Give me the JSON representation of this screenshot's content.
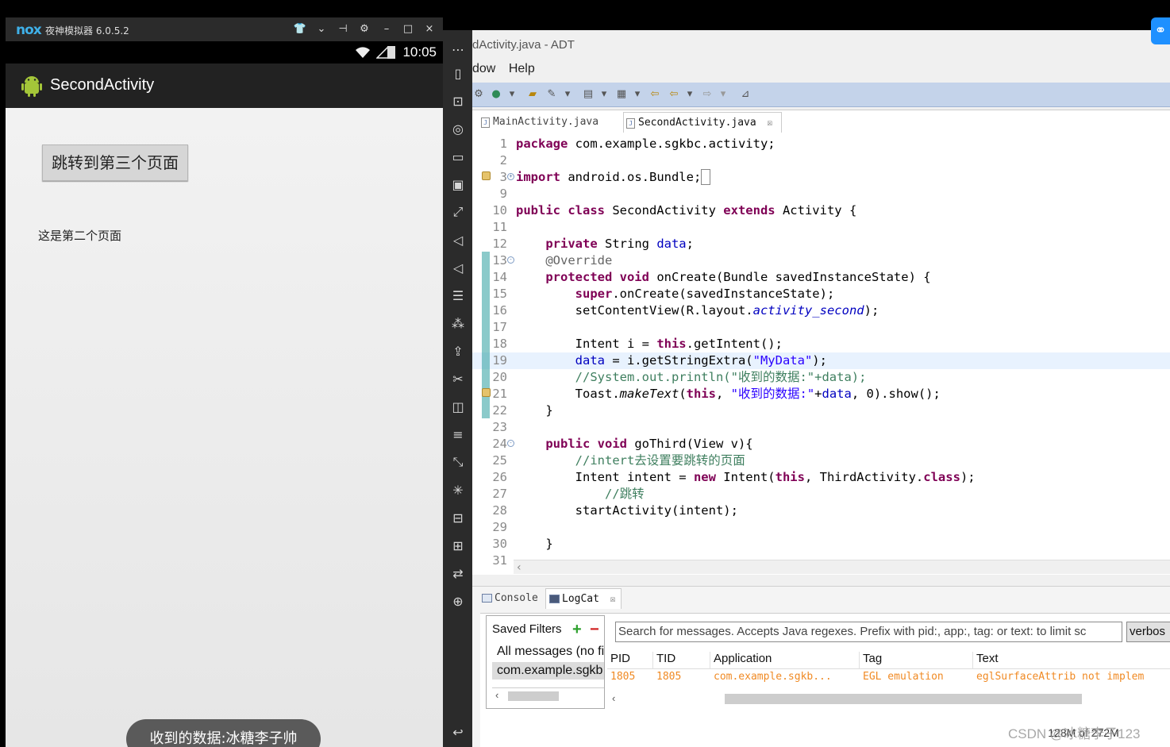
{
  "emulator": {
    "title": "夜神模拟器 6.0.5.2",
    "logo_text": "nox",
    "controls": [
      "shirt-icon",
      "chevron-down-icon",
      "pin-icon",
      "gear-icon",
      "minimize-icon",
      "maximize-icon",
      "close-icon"
    ],
    "status_time": "10:05",
    "app_title": "SecondActivity",
    "button_label": "跳转到第三个页面",
    "page_text": "这是第二个页面",
    "toast": "收到的数据:冰糖李子帅"
  },
  "side_toolbar": [
    "more-icon",
    "phone-icon",
    "robot-icon",
    "location-icon",
    "keyboard-icon",
    "screenshot-icon",
    "fullscreen-icon",
    "volume-up-icon",
    "volume-down-icon",
    "apk-icon",
    "shake-icon",
    "install-icon",
    "cut-icon",
    "multi-window-icon",
    "menu-icon",
    "resize-icon",
    "loading-icon",
    "camera-icon",
    "controller-icon",
    "sync-icon",
    "add-icon",
    "back-icon"
  ],
  "ide": {
    "title": "dActivity.java - ADT",
    "menu": [
      "dow",
      "Help"
    ],
    "tabs": [
      {
        "label": "MainActivity.java",
        "active": false
      },
      {
        "label": "SecondActivity.java",
        "active": true,
        "close": "☒"
      }
    ],
    "code_lines": [
      {
        "n": "1",
        "html": "<span class=\"kw\">package</span> com.example.sgkbc.activity;"
      },
      {
        "n": "2",
        "html": ""
      },
      {
        "n": "3",
        "html": "<span class=\"kw\">import</span> android.os.Bundle;<span style=\"border:1px solid #888;\">&nbsp;</span>",
        "fold": "+"
      },
      {
        "n": "9",
        "html": ""
      },
      {
        "n": "10",
        "html": "<span class=\"kw\">public class</span> SecondActivity <span class=\"kw\">extends</span> Activity {"
      },
      {
        "n": "11",
        "html": ""
      },
      {
        "n": "12",
        "html": "    <span class=\"kw\">private</span> String <span class=\"fld\">data</span>;"
      },
      {
        "n": "13",
        "html": "    <span class=\"ann\">@Override</span>",
        "fold": "-"
      },
      {
        "n": "14",
        "html": "    <span class=\"kw\">protected void</span> onCreate(Bundle savedInstanceState) {"
      },
      {
        "n": "15",
        "html": "        <span class=\"kw\">super</span>.onCreate(savedInstanceState);"
      },
      {
        "n": "16",
        "html": "        setContentView(R.layout.<span class=\"fld it\">activity_second</span>);"
      },
      {
        "n": "17",
        "html": ""
      },
      {
        "n": "18",
        "html": "        Intent i = <span class=\"kw\">this</span>.getIntent();"
      },
      {
        "n": "19",
        "html": "        <span class=\"fld\">data</span> = i.getStringExtra(<span class=\"str\">\"MyData\"</span>);",
        "hl": true
      },
      {
        "n": "20",
        "html": "        <span class=\"cm\">//System.out.println(\"收到的数据:\"+data);</span>"
      },
      {
        "n": "21",
        "html": "        Toast.<span class=\"it\">makeText</span>(<span class=\"kw\">this</span>, <span class=\"str\">\"收到的数据:\"</span>+<span class=\"fld\">data</span>, 0).show();"
      },
      {
        "n": "22",
        "html": "    }"
      },
      {
        "n": "23",
        "html": ""
      },
      {
        "n": "24",
        "html": "    <span class=\"kw\">public void</span> goThird(View v){",
        "fold": "-"
      },
      {
        "n": "25",
        "html": "        <span class=\"cm\">//intert去设置要跳转的页面</span>"
      },
      {
        "n": "26",
        "html": "        Intent intent = <span class=\"kw\">new</span> Intent(<span class=\"kw\">this</span>, ThirdActivity.<span class=\"kw\">class</span>);"
      },
      {
        "n": "27",
        "html": "            <span class=\"cm\">//跳转</span>"
      },
      {
        "n": "28",
        "html": "        startActivity(intent);"
      },
      {
        "n": "29",
        "html": ""
      },
      {
        "n": "30",
        "html": "    }"
      },
      {
        "n": "31",
        "html": ""
      }
    ],
    "bottom_tabs": [
      {
        "label": "Console",
        "active": false
      },
      {
        "label": "LogCat",
        "active": true,
        "close": "☒"
      }
    ],
    "logcat": {
      "saved_filters": "Saved Filters",
      "filters": [
        "All messages (no fi",
        "com.example.sgkb"
      ],
      "search_placeholder": "Search for messages. Accepts Java regexes. Prefix with pid:, app:, tag: or text: to limit sc",
      "level": "verbos",
      "columns": [
        "PID",
        "TID",
        "Application",
        "Tag",
        "Text"
      ],
      "rows": [
        {
          "pid": "1805",
          "tid": "1805",
          "app": "com.example.sgkb...",
          "tag": "EGL emulation",
          "text": "eglSurfaceAttrib not implem"
        }
      ]
    },
    "memory": "128M of 272M"
  },
  "watermark": "CSDN @冰糖李子123"
}
